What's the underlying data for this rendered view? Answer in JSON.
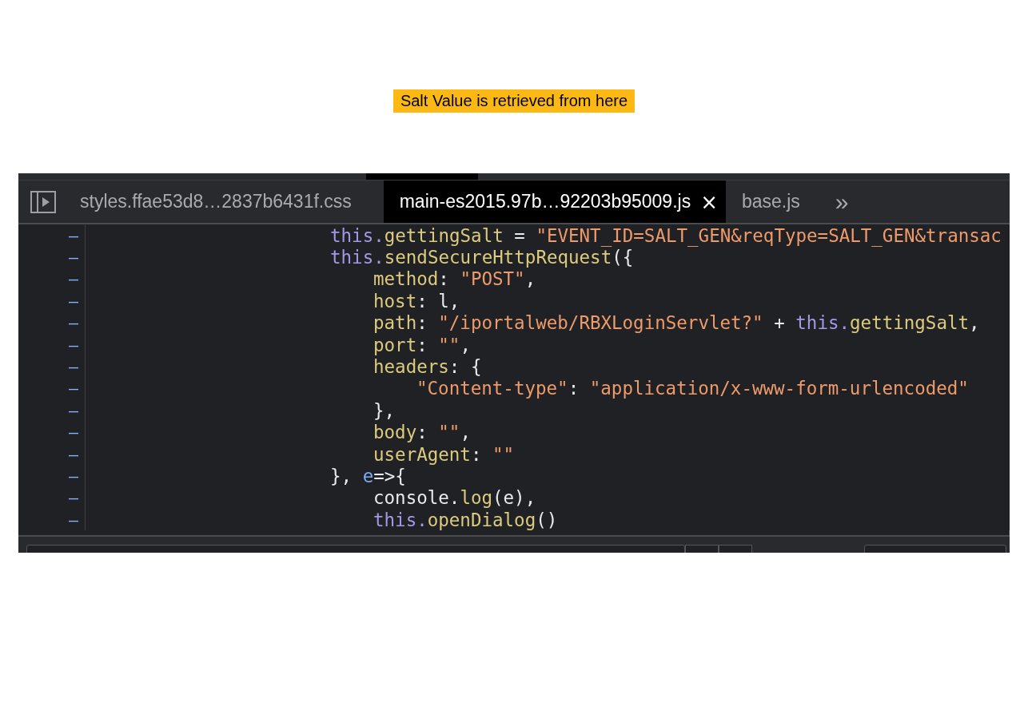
{
  "caption": "Salt Value is retrieved from here",
  "tabs": [
    {
      "label": "styles.ffae53d8…2837b6431f.css",
      "selected": false
    },
    {
      "label": "main-es2015.97b…92203b95009.js",
      "selected": true
    },
    {
      "label": "base.js",
      "selected": false
    }
  ],
  "more_tabs": "»",
  "close": "×",
  "code_lines": [
    {
      "marker": "–",
      "kind": "outer",
      "tokens": [
        {
          "kind": "keyword",
          "text": "this."
        },
        {
          "kind": "prop",
          "text": "gettingSalt"
        },
        {
          "kind": "plain",
          "text": " = "
        },
        {
          "kind": "string",
          "text": "\"EVENT_ID=SALT_GEN&reqType=SALT_GEN&transac"
        }
      ]
    },
    {
      "marker": "–",
      "kind": "outer",
      "tokens": [
        {
          "kind": "keyword",
          "text": "this."
        },
        {
          "kind": "prop",
          "text": "sendSecureHttpRequest"
        },
        {
          "kind": "plain",
          "text": "({"
        }
      ]
    },
    {
      "marker": "–",
      "kind": "inner",
      "tokens": [
        {
          "kind": "prop",
          "text": "method"
        },
        {
          "kind": "plain",
          "text": ": "
        },
        {
          "kind": "string",
          "text": "\"POST\""
        },
        {
          "kind": "plain",
          "text": ","
        }
      ]
    },
    {
      "marker": "–",
      "kind": "inner",
      "tokens": [
        {
          "kind": "prop",
          "text": "host"
        },
        {
          "kind": "plain",
          "text": ": l,"
        }
      ]
    },
    {
      "marker": "–",
      "kind": "inner",
      "tokens": [
        {
          "kind": "prop",
          "text": "path"
        },
        {
          "kind": "plain",
          "text": ": "
        },
        {
          "kind": "string",
          "text": "\"/iportalweb/RBXLoginServlet?\""
        },
        {
          "kind": "plain",
          "text": " + "
        },
        {
          "kind": "keyword",
          "text": "this."
        },
        {
          "kind": "prop",
          "text": "gettingSalt"
        },
        {
          "kind": "plain",
          "text": ","
        }
      ]
    },
    {
      "marker": "–",
      "kind": "inner",
      "tokens": [
        {
          "kind": "prop",
          "text": "port"
        },
        {
          "kind": "plain",
          "text": ": "
        },
        {
          "kind": "string",
          "text": "\"\""
        },
        {
          "kind": "plain",
          "text": ","
        }
      ]
    },
    {
      "marker": "–",
      "kind": "inner",
      "tokens": [
        {
          "kind": "prop",
          "text": "headers"
        },
        {
          "kind": "plain",
          "text": ": {"
        }
      ]
    },
    {
      "marker": "–",
      "kind": "deep",
      "tokens": [
        {
          "kind": "string",
          "text": "\"Content-type\""
        },
        {
          "kind": "plain",
          "text": ": "
        },
        {
          "kind": "string",
          "text": "\"application/x-www-form-urlencoded\""
        }
      ]
    },
    {
      "marker": "–",
      "kind": "inner",
      "tokens": [
        {
          "kind": "plain",
          "text": "},"
        }
      ]
    },
    {
      "marker": "–",
      "kind": "inner",
      "tokens": [
        {
          "kind": "prop",
          "text": "body"
        },
        {
          "kind": "plain",
          "text": ": "
        },
        {
          "kind": "string",
          "text": "\"\""
        },
        {
          "kind": "plain",
          "text": ","
        }
      ]
    },
    {
      "marker": "–",
      "kind": "inner",
      "tokens": [
        {
          "kind": "prop",
          "text": "userAgent"
        },
        {
          "kind": "plain",
          "text": ": "
        },
        {
          "kind": "string",
          "text": "\"\""
        }
      ]
    },
    {
      "marker": "–",
      "kind": "outer",
      "tokens": [
        {
          "kind": "plain",
          "text": "}, "
        },
        {
          "kind": "param",
          "text": "e"
        },
        {
          "kind": "plain",
          "text": "=>{"
        }
      ]
    },
    {
      "marker": "–",
      "kind": "inner",
      "tokens": [
        {
          "kind": "plain",
          "text": "console."
        },
        {
          "kind": "prop",
          "text": "log"
        },
        {
          "kind": "plain",
          "text": "(e),"
        }
      ]
    },
    {
      "marker": "–",
      "kind": "inner",
      "tokens": [
        {
          "kind": "keyword",
          "text": "this."
        },
        {
          "kind": "prop",
          "text": "openDialog"
        },
        {
          "kind": "plain",
          "text": "()"
        }
      ]
    }
  ]
}
